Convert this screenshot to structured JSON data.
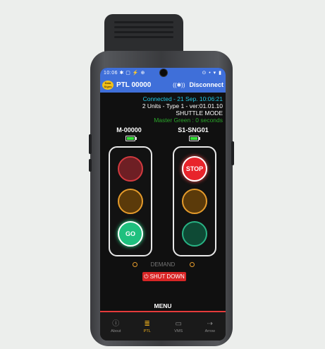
{
  "status_bar": {
    "time": "10:06",
    "left_icons": "✱ ▢ ⚡ ⊕",
    "right_icons": "⊙ • ▾ ▮"
  },
  "app_bar": {
    "logo_text": "Data Signs",
    "title": "PTL 00000",
    "bluetooth_icon": "((✱))",
    "disconnect_label": "Disconnect"
  },
  "info": {
    "connection": "Connected - 21 Sep. 10:06:21",
    "units": "2 Units - Type 1 - ver:01.01.10",
    "mode": "SHUTTLE MODE",
    "master": "Master Green : 0 seconds"
  },
  "units": [
    {
      "name": "M-00000",
      "battery_level": 1.0,
      "go_label": "GO",
      "stop_label": "",
      "active_lamp": "green"
    },
    {
      "name": "S1-SNG01",
      "battery_level": 1.0,
      "go_label": "",
      "stop_label": "STOP",
      "active_lamp": "red"
    }
  ],
  "demand": {
    "label": "DEMAND"
  },
  "shutdown": {
    "icon": "⏻",
    "label": "SHUT DOWN"
  },
  "menu": {
    "label": "MENU"
  },
  "nav": [
    {
      "label": "About",
      "icon": "ⓘ",
      "active": false
    },
    {
      "label": "PTL",
      "icon": "≣",
      "active": true
    },
    {
      "label": "VMS",
      "icon": "▭",
      "active": false
    },
    {
      "label": "Arrow",
      "icon": "⇢",
      "active": false
    }
  ],
  "colors": {
    "accent": "#3f6fd9",
    "active_nav": "#f2b21b",
    "cyan": "#21c9e6",
    "green_text": "#2aa62a",
    "shutdown": "#d82525"
  }
}
